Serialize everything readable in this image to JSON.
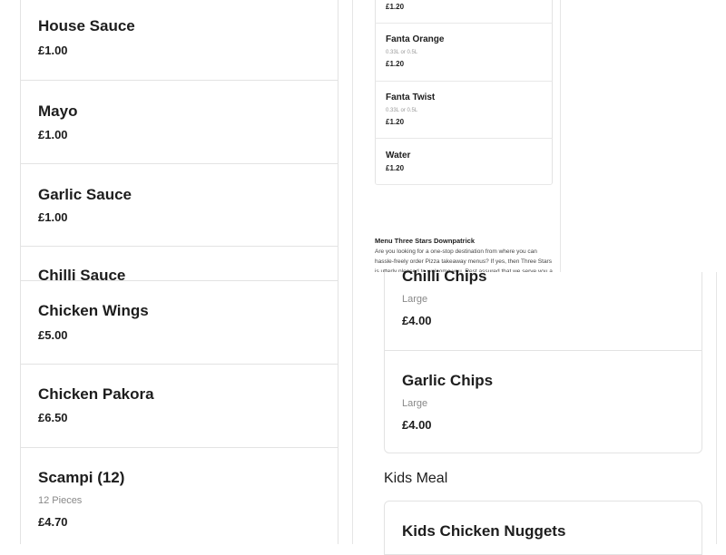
{
  "left_top_items": [
    {
      "name": "House Sauce",
      "price": "£1.00"
    },
    {
      "name": "Mayo",
      "price": "£1.00"
    },
    {
      "name": "Garlic Sauce",
      "price": "£1.00"
    },
    {
      "name": "Chilli Sauce"
    }
  ],
  "left_bottom_items": [
    {
      "name": "Chicken Wings",
      "price": "£5.00"
    },
    {
      "name": "Chicken Pakora",
      "price": "£6.50"
    },
    {
      "name": "Scampi (12)",
      "desc": "12 Pieces",
      "price": "£4.70"
    }
  ],
  "drinks": {
    "partial_price": "£1.20",
    "items": [
      {
        "name": "Fanta Orange",
        "desc": "0.33L or 0.5L",
        "price": "£1.20"
      },
      {
        "name": "Fanta Twist",
        "desc": "0.33L or 0.5L",
        "price": "£1.20"
      },
      {
        "name": "Water",
        "price": "£1.20"
      }
    ]
  },
  "about": {
    "title": "Menu Three Stars Downpatrick",
    "text": "Are you looking for a one-stop destination from where you can hassle-freely order Pizza takeaway menus? If yes, then Three Stars is utterly pleased to welcome you. Rest assured that we serve you a brilliant"
  },
  "right_items": [
    {
      "name": "Chilli Chips",
      "desc": "Large",
      "price": "£4.00"
    },
    {
      "name": "Garlic Chips",
      "desc": "Large",
      "price": "£4.00"
    }
  ],
  "kids_meal": {
    "heading": "Kids Meal",
    "first_item": "Kids Chicken Nuggets"
  }
}
